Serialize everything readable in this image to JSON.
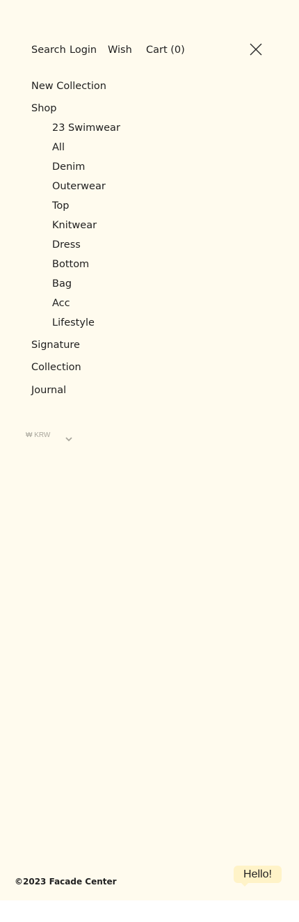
{
  "topnav": {
    "search": "Search",
    "login": "Login",
    "wish": "Wish",
    "cart": "Cart (0)",
    "close_icon": "close-x-icon"
  },
  "menu": {
    "new_collection": "New Collection",
    "shop": "Shop",
    "shop_items": [
      "23 Swimwear",
      "All",
      "Denim",
      "Outerwear",
      "Top",
      "Knitwear",
      "Dress",
      "Bottom",
      "Bag",
      "Acc",
      "Lifestyle"
    ],
    "signature": "Signature",
    "collection": "Collection",
    "journal": "Journal"
  },
  "currency": {
    "selected": "₩ KRW",
    "icon": "chevron-down-icon"
  },
  "footer": {
    "copyright": "©2023 Facade Center",
    "chat_bubble": "Hello!"
  },
  "colors": {
    "panel_background": "#fffbee",
    "chat_bubble_background": "#fff3c8",
    "text": "#1e1e1e"
  }
}
